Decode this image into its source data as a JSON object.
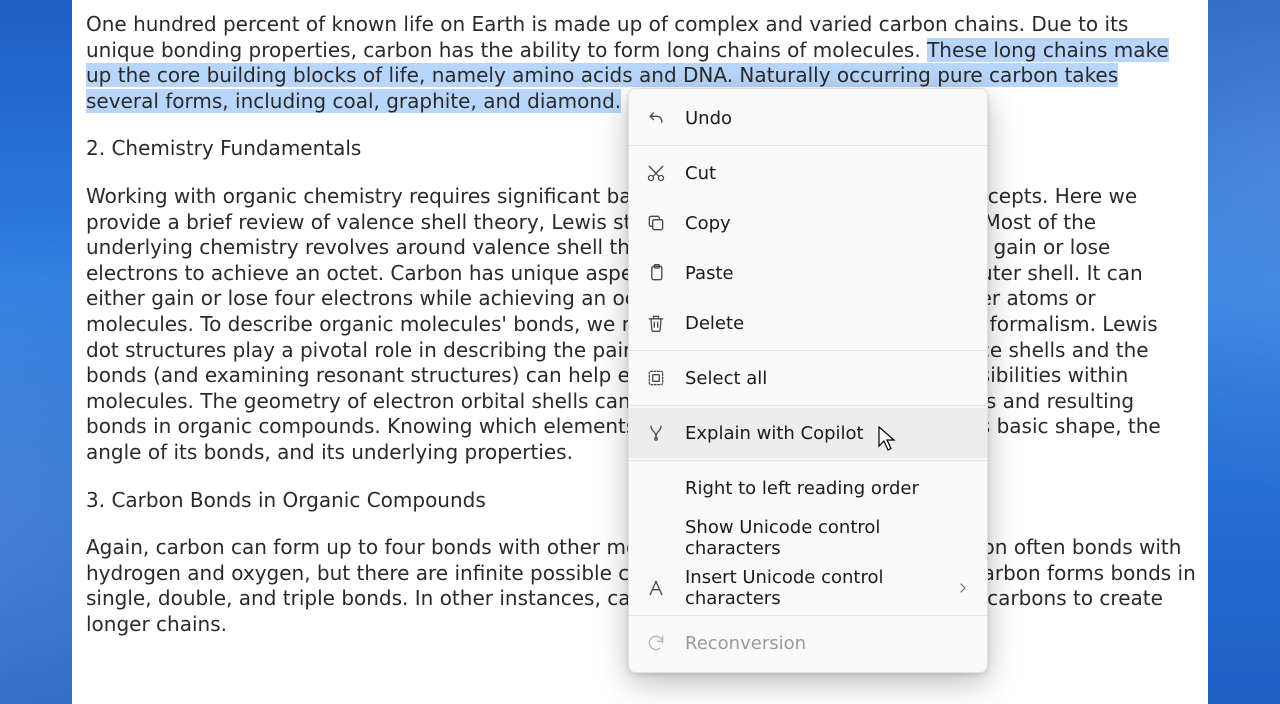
{
  "document": {
    "para1_before_sel": "One hundred percent of known life on Earth is made up of complex and varied carbon chains. Due to its unique bonding properties, carbon has the ability to form long chains of molecules. ",
    "para1_sel": "These long chains make up the core building blocks of life, namely amino acids and DNA. Naturally occurring pure carbon takes several forms, including coal, graphite, and diamond.",
    "heading2": "2. Chemistry Fundamentals",
    "para2": "Working with organic chemistry requires significant background in classical chemistry concepts. Here we provide a brief review of valence shell theory, Lewis structures, and molecular geometry. Most of the underlying chemistry revolves around valence shell theory—the idea that all atoms either gain or lose electrons to achieve an octet. Carbon has unique aspect due to the four electrons in its outer shell. It can either gain or lose four electrons while achieving an octet, or form atomic bonds with other atoms or molecules. To describe organic molecules' bonds, we need to draw on Lewis dot structure formalism. Lewis dot structures play a pivotal role in describing the paired and unpaired electrons in valence shells and the bonds (and examining resonant structures) can help explain the shapes and bonding possibilities within molecules. The geometry of electron orbital shells can help illuminate the eventual shapes and resulting bonds in organic compounds. Knowing which elements comprise a molecule can tell us its basic shape, the angle of its bonds, and its underlying properties.",
    "heading3": "3. Carbon Bonds in Organic Compounds",
    "para3": "Again, carbon can form up to four bonds with other molecules. In organic chemistry, carbon often bonds with hydrogen and oxygen, but there are infinite possible compounds. In the simplest forms, carbon forms bonds in single, double, and triple bonds. In other instances, carbon forms single bonds with other carbons to create longer chains."
  },
  "menu": {
    "undo": "Undo",
    "cut": "Cut",
    "copy": "Copy",
    "paste": "Paste",
    "delete": "Delete",
    "select_all": "Select all",
    "explain": "Explain with Copilot",
    "rtl": "Right to left reading order",
    "show_uni": "Show Unicode control characters",
    "insert_uni": "Insert Unicode control characters",
    "reconversion": "Reconversion"
  }
}
